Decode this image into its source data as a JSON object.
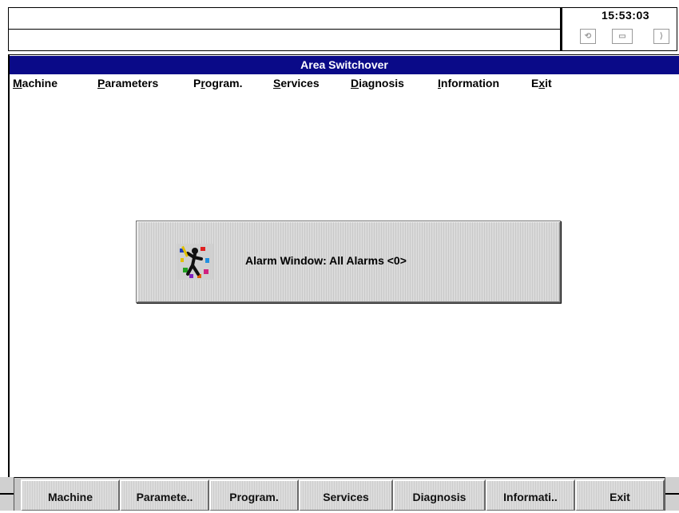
{
  "status": {
    "time": "15:53:03",
    "icons": [
      "cycle-icon",
      "percent-icon",
      "exit-door-icon"
    ],
    "icon_glyphs": [
      "⟲",
      "▭",
      "⟩"
    ]
  },
  "window": {
    "title": "Area Switchover"
  },
  "menu": [
    {
      "label": "Machine",
      "mnemonic": "M"
    },
    {
      "label": "Parameters",
      "mnemonic": "P"
    },
    {
      "label": "Program.",
      "mnemonic": "r"
    },
    {
      "label": "Services",
      "mnemonic": "S"
    },
    {
      "label": "Diagnosis",
      "mnemonic": "D"
    },
    {
      "label": "Information",
      "mnemonic": "I"
    },
    {
      "label": "Exit",
      "mnemonic": "x"
    }
  ],
  "alarm": {
    "text": "Alarm Window: All Alarms <0>",
    "icon": "alarm-person-icon"
  },
  "softkeys": [
    "Machine",
    "Paramete..",
    "Program.",
    "Services",
    "Diagnosis",
    "Informati..",
    "Exit"
  ],
  "colors": {
    "title_bar": "#0a0a88",
    "panel_gray": "#d4d4d4"
  }
}
